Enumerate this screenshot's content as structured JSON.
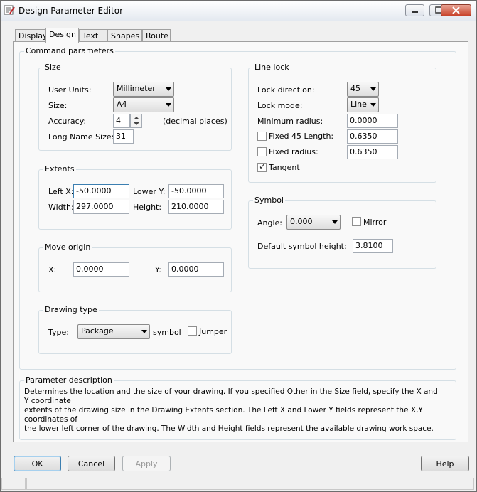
{
  "window": {
    "title": "Design Parameter Editor"
  },
  "tabs": [
    "Display",
    "Design",
    "Text",
    "Shapes",
    "Route"
  ],
  "command_parameters": {
    "label": "Command parameters",
    "size": {
      "label": "Size",
      "user_units_label": "User Units:",
      "user_units": "Millimeter",
      "size_label": "Size:",
      "size": "A4",
      "accuracy_label": "Accuracy:",
      "accuracy": "4",
      "accuracy_note": "(decimal places)",
      "long_name_label": "Long Name Size:",
      "long_name": "31"
    },
    "extents": {
      "label": "Extents",
      "left_x_label": "Left X:",
      "left_x": "-50.0000",
      "lower_y_label": "Lower Y:",
      "lower_y": "-50.0000",
      "width_label": "Width:",
      "width": "297.0000",
      "height_label": "Height:",
      "height": "210.0000"
    },
    "move_origin": {
      "label": "Move origin",
      "x_label": "X:",
      "x": "0.0000",
      "y_label": "Y:",
      "y": "0.0000"
    },
    "drawing_type": {
      "label": "Drawing type",
      "type_label": "Type:",
      "type": "Package",
      "symbol_label": "symbol",
      "jumper_label": "Jumper",
      "jumper_checked": false
    },
    "line_lock": {
      "label": "Line lock",
      "lock_direction_label": "Lock direction:",
      "lock_direction": "45",
      "lock_mode_label": "Lock mode:",
      "lock_mode": "Line",
      "min_radius_label": "Minimum radius:",
      "min_radius": "0.0000",
      "fixed45_label": "Fixed 45 Length:",
      "fixed45": "0.6350",
      "fixed45_checked": false,
      "fixed_radius_label": "Fixed radius:",
      "fixed_radius": "0.6350",
      "fixed_radius_checked": false,
      "tangent_label": "Tangent",
      "tangent_checked": true
    },
    "symbol": {
      "label": "Symbol",
      "angle_label": "Angle:",
      "angle": "0.000",
      "mirror_label": "Mirror",
      "mirror_checked": false,
      "default_height_label": "Default symbol height:",
      "default_height": "3.8100"
    }
  },
  "parameter_description": {
    "label": "Parameter description",
    "lines": [
      "Determines the location and the size of your drawing.  If you specified Other in the Size field, specify the X and Y coordinate",
      "extents of the drawing size in the Drawing Extents section. The Left X and Lower Y fields represent the X,Y coordinates of",
      "the lower left corner of the drawing.  The Width and Height fields represent the available drawing work space."
    ]
  },
  "buttons": {
    "ok": "OK",
    "cancel": "Cancel",
    "apply": "Apply",
    "help": "Help"
  },
  "colors": {
    "accent": "#3c7fb1",
    "close_button": "#c8432b"
  }
}
